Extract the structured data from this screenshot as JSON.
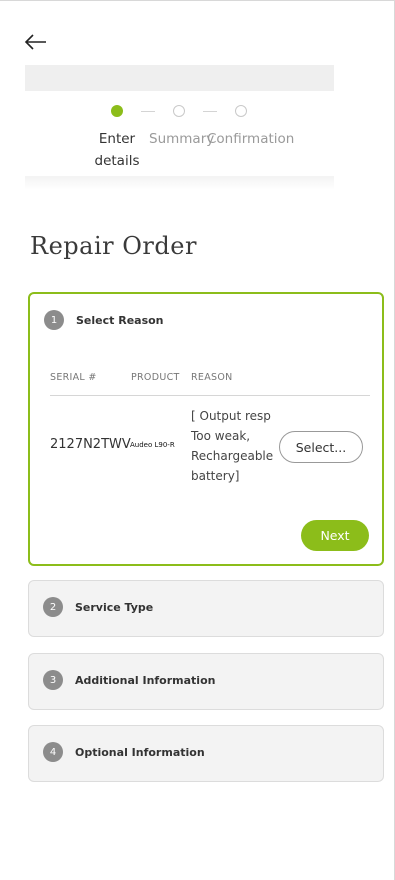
{
  "header": {
    "back_icon": "arrow-left-icon"
  },
  "stepper": {
    "steps": [
      {
        "label_line1": "Enter",
        "label_line2": "details",
        "state": "active"
      },
      {
        "label": "Summary",
        "state": "inactive"
      },
      {
        "label": "Confirmation",
        "state": "inactive"
      }
    ],
    "active_color": "#8cbd1a"
  },
  "page": {
    "title": "Repair Order"
  },
  "sections": [
    {
      "number": "1",
      "label": "Select Reason",
      "state": "open",
      "table": {
        "headers": [
          "SERIAL #",
          "PRODUCT",
          "REASON"
        ],
        "rows": [
          {
            "serial": "2127N2TWV",
            "product": "Audeo L90-R",
            "reason_lines": [
              "[ Output resp",
              "Too weak,",
              "Rechargeable",
              "battery]"
            ],
            "select_label": "Select..."
          }
        ]
      },
      "next_label": "Next"
    },
    {
      "number": "2",
      "label": "Service Type",
      "state": "collapsed"
    },
    {
      "number": "3",
      "label": "Additional Information",
      "state": "collapsed"
    },
    {
      "number": "4",
      "label": "Optional Information",
      "state": "collapsed"
    }
  ]
}
